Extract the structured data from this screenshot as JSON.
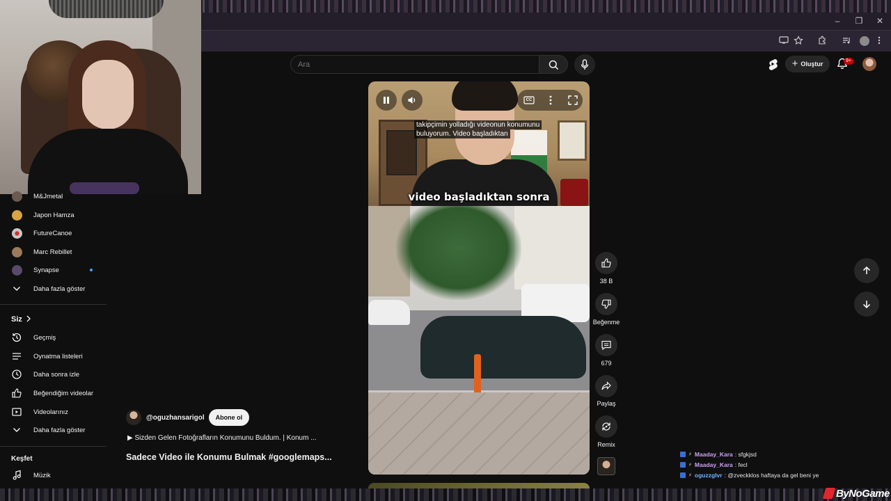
{
  "browser": {
    "window_controls": {
      "minimize": "–",
      "restore": "❐",
      "close": "✕"
    }
  },
  "header": {
    "search": {
      "placeholder": "Ara"
    },
    "create_label": "Oluştur",
    "notifications_badge": "9+"
  },
  "sidebar": {
    "subscriptions": [
      {
        "label": "M&Jmetal",
        "avatar_color": "#6b5a4e"
      },
      {
        "label": "Japon Hamza",
        "avatar_color": "#d9a441"
      },
      {
        "label": "FutureCanoe",
        "avatar_color": "#c7c7c7"
      },
      {
        "label": "Marc Rebillet",
        "avatar_color": "#9a7a5a"
      },
      {
        "label": "Synapse",
        "avatar_color": "#5a4a6a",
        "new_content": true
      }
    ],
    "show_more_1": "Daha fazla göster",
    "you_heading": "Siz",
    "you_items": [
      {
        "label": "Geçmiş",
        "icon": "history-icon"
      },
      {
        "label": "Oynatma listeleri",
        "icon": "playlist-icon"
      },
      {
        "label": "Daha sonra izle",
        "icon": "watch-later-icon"
      },
      {
        "label": "Beğendiğim videolar",
        "icon": "like-icon"
      },
      {
        "label": "Videolarınız",
        "icon": "your-videos-icon"
      }
    ],
    "show_more_2": "Daha fazla göster",
    "explore_heading": "Keşfet",
    "explore_items": [
      {
        "label": "Müzik",
        "icon": "music-icon"
      }
    ]
  },
  "player": {
    "subtitle_line1": "takipçimin yolladığı videonun konumunu",
    "subtitle_line2": "buluyorum. Video başladıktan",
    "burned_caption": "video başladıktan sonra",
    "cc_label": "CC"
  },
  "video": {
    "channel": "@oguzhansarigol",
    "subscribe_label": "Abone ol",
    "playlist_line": "▶ Sizden Gelen Fotoğrafların Konumunu Buldum. | Konum ...",
    "title": "Sadece Video ile Konumu Bulmak #googlemaps..."
  },
  "actions": {
    "like_count": "38 B",
    "dislike_label": "Beğenme",
    "comment_count": "679",
    "share_label": "Paylaş",
    "remix_label": "Remix"
  },
  "chat": [
    {
      "user": "Maaday_Kara",
      "user_color": "#c9a0f0",
      "message": ": sfgkjsd"
    },
    {
      "user": "Maaday_Kara",
      "user_color": "#c9a0f0",
      "message": ": fecl"
    },
    {
      "user": "oguzzglvr",
      "user_color": "#6fb3ff",
      "message": ": @zveckklos haftaya da gel beni ye"
    }
  ],
  "watermark": "ByNoGame"
}
